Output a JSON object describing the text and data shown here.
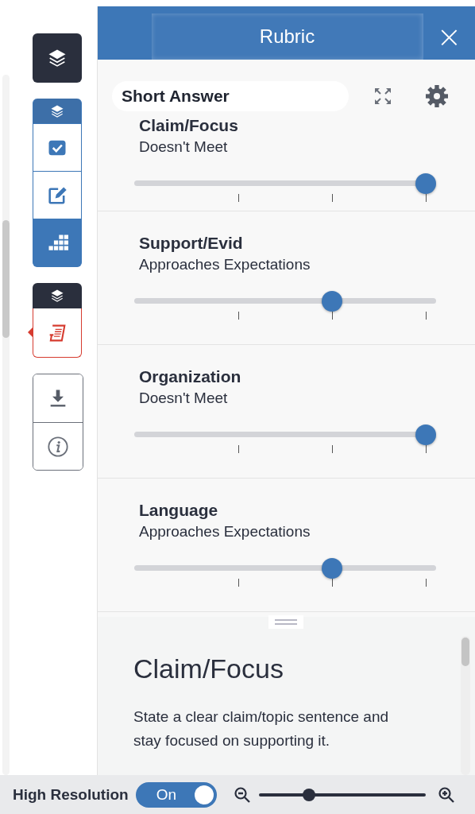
{
  "panel": {
    "title": "Rubric",
    "close": "×"
  },
  "rubric": {
    "name": "Short Answer",
    "criteria": [
      {
        "name": "Claim/Focus",
        "rating": "Doesn't Meet",
        "level": 1
      },
      {
        "name": "Support/Evid",
        "rating": "Approaches Expectations",
        "level": 0.667
      },
      {
        "name": "Organization",
        "rating": "Doesn't Meet",
        "level": 1
      },
      {
        "name": "Language",
        "rating": "Approaches Expectations",
        "level": 0.667
      }
    ]
  },
  "sidebar": {
    "groups": [
      {
        "kind": "single",
        "items": [
          {
            "selected": false
          }
        ]
      },
      {
        "kind": "blue",
        "items": [
          {
            "selected": false
          },
          {
            "selected": false
          },
          {
            "selected": false
          },
          {
            "selected": true
          }
        ]
      },
      {
        "kind": "red",
        "items": [
          {
            "selected": false
          },
          {
            "selected": true
          }
        ]
      },
      {
        "kind": "plain",
        "items": [
          {
            "selected": false
          },
          {
            "selected": false
          }
        ]
      }
    ]
  },
  "description": {
    "title": "Claim/Focus",
    "text": "State a clear claim/topic sentence and stay focused on supporting it."
  },
  "footer": {
    "label": "High Resolution",
    "toggle": {
      "label": "On",
      "on": true
    },
    "zoom": {
      "level": 0.3
    }
  }
}
